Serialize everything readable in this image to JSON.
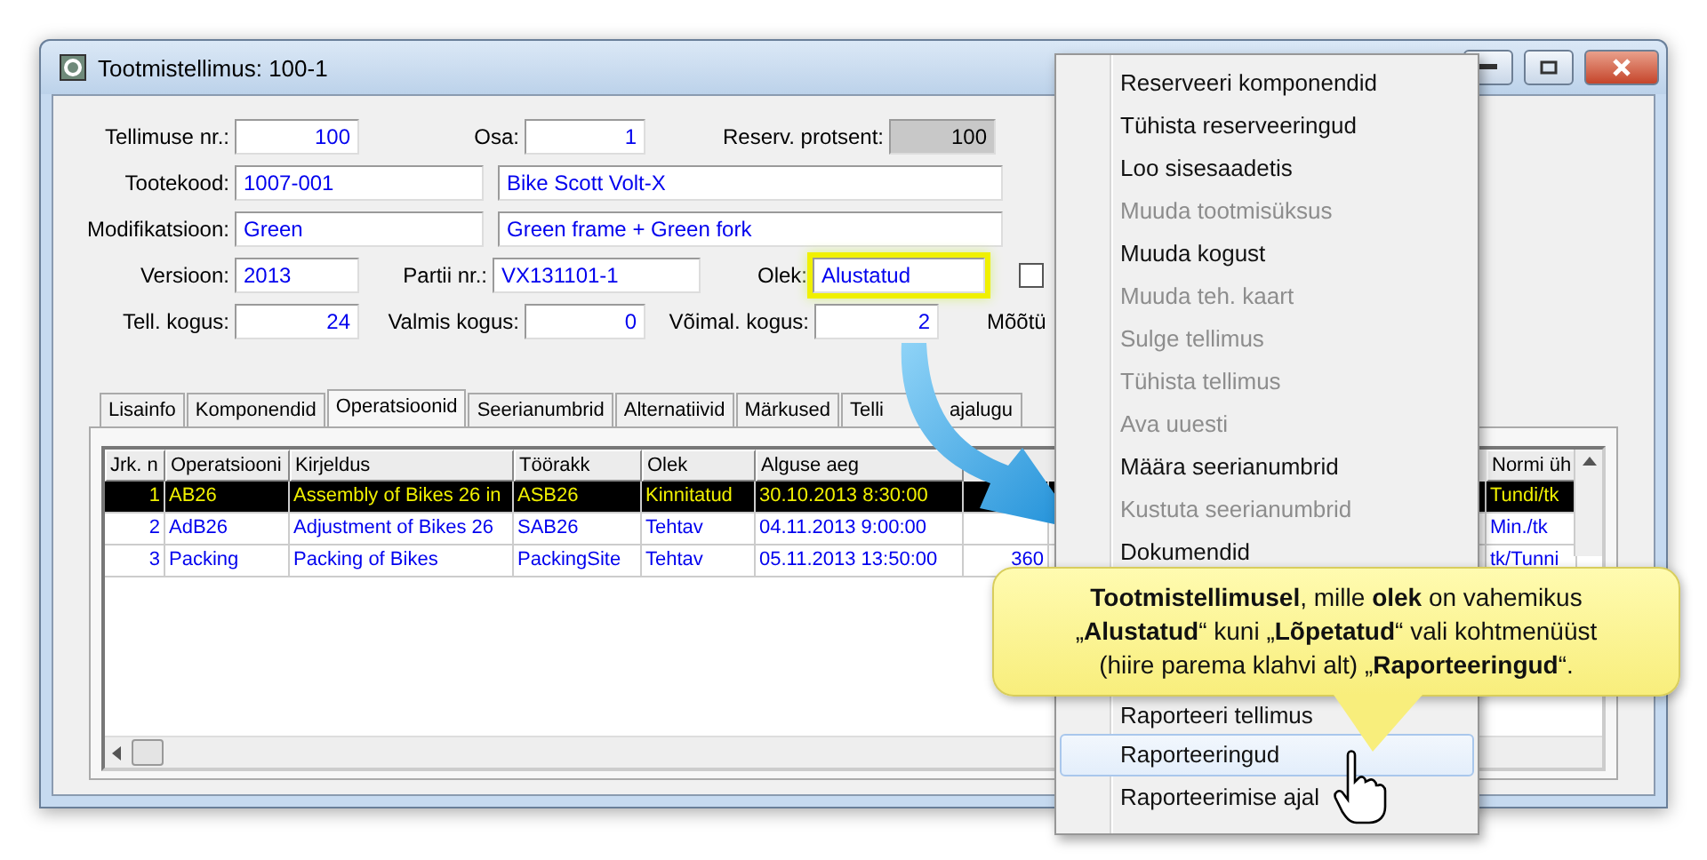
{
  "window": {
    "title": "Tootmistellimus: 100-1"
  },
  "form": {
    "rows": [
      [
        {
          "label": "Tellimuse nr.:",
          "value": "100"
        },
        {
          "label": "Osa:",
          "value": "1"
        },
        {
          "label": "Reserv. protsent:",
          "value": "100",
          "disabled": true
        }
      ],
      [
        {
          "label": "Tootekood:",
          "value": "1007-001"
        },
        {
          "value": "Bike Scott Volt-X"
        }
      ],
      [
        {
          "label": "Modifikatsioon:",
          "value": "Green"
        },
        {
          "value": "Green frame + Green fork"
        }
      ],
      [
        {
          "label": "Versioon:",
          "value": "2013"
        },
        {
          "label": "Partii nr.:",
          "value": "VX131101-1"
        },
        {
          "label": "Olek:",
          "value": "Alustatud",
          "highlighted": true
        },
        {
          "kind": "checkbox",
          "checked": false
        }
      ],
      [
        {
          "label": "Tell. kogus:",
          "value": "24"
        },
        {
          "label": "Valmis kogus:",
          "value": "0"
        },
        {
          "label": "Võimal. kogus:",
          "value": "2"
        },
        {
          "kind": "label",
          "label": "Mõõtü"
        }
      ]
    ]
  },
  "tabs": [
    {
      "label": "Lisainfo",
      "selected": false
    },
    {
      "label": "Komponendid",
      "selected": false
    },
    {
      "label": "Operatsioonid",
      "selected": true
    },
    {
      "label": "Seerianumbrid",
      "selected": false
    },
    {
      "label": "Alternatiivid",
      "selected": false
    },
    {
      "label": "Märkused",
      "selected": false
    },
    {
      "label": "Telli ajalugu",
      "selected": false
    }
  ],
  "table": {
    "columns": [
      {
        "label": "Jrk. n"
      },
      {
        "label": "Operatsiooni"
      },
      {
        "label": "Kirjeldus"
      },
      {
        "label": "Töörakk"
      },
      {
        "label": "Olek"
      },
      {
        "label": "Alguse aeg"
      },
      {},
      {},
      {
        "label": "Normi üh"
      }
    ],
    "rows": [
      {
        "selected": true,
        "cells": [
          "1",
          "AB26",
          "Assembly of Bikes 26 in",
          "ASB26",
          "Kinnitatud",
          "30.10.2013 8:30:00",
          null,
          null,
          "Tundi/tk"
        ]
      },
      {
        "selected": false,
        "cells": [
          "2",
          "AdB26",
          "Adjustment of Bikes 26",
          "SAB26",
          "Tehtav",
          "04.11.2013 9:00:00",
          null,
          null,
          "Min./tk"
        ]
      },
      {
        "selected": false,
        "cells": [
          "3",
          "Packing",
          "Packing of Bikes",
          "PackingSite",
          "Tehtav",
          "05.11.2013 13:50:00",
          "360",
          null,
          "tk/Tunni"
        ]
      }
    ]
  },
  "context_menu": {
    "items": [
      {
        "label": "Reserveeri komponendid",
        "disabled": false,
        "selected": false
      },
      {
        "label": "Tühista reserveeringud",
        "disabled": false,
        "selected": false
      },
      {
        "label": "Loo sisesaadetis",
        "disabled": false,
        "selected": false
      },
      {
        "label": "Muuda tootmisüksus",
        "disabled": true,
        "selected": false
      },
      {
        "label": "Muuda kogust",
        "disabled": false,
        "selected": false
      },
      {
        "label": "Muuda teh. kaart",
        "disabled": true,
        "selected": false
      },
      {
        "label": "Sulge tellimus",
        "disabled": true,
        "selected": false
      },
      {
        "label": "Tühista tellimus",
        "disabled": true,
        "selected": false
      },
      {
        "label": "Ava uuesti",
        "disabled": true,
        "selected": false
      },
      {
        "label": "Määra seerianumbrid",
        "disabled": false,
        "selected": false
      },
      {
        "label": "Kustuta seerianumbrid",
        "disabled": true,
        "selected": false
      },
      {
        "label": "Dokumendid",
        "disabled": false,
        "selected": false
      },
      {
        "kind": "hidden"
      },
      {
        "label": "Raporteeri tellimus",
        "disabled": false,
        "selected": false
      },
      {
        "label": "Raporteeringud",
        "disabled": false,
        "selected": true
      },
      {
        "label": "Raporteerimise ajal",
        "disabled": false,
        "selected": false
      }
    ]
  },
  "callout": {
    "text": "**Tootmistellimusel**, mille **olek** on vahemikus\n„**Alustatud**“ kuni „**Lõpetatud**“ vali kohtmenüüst\n(hiire parema klahvi alt) „**Raporteeringud**“."
  }
}
